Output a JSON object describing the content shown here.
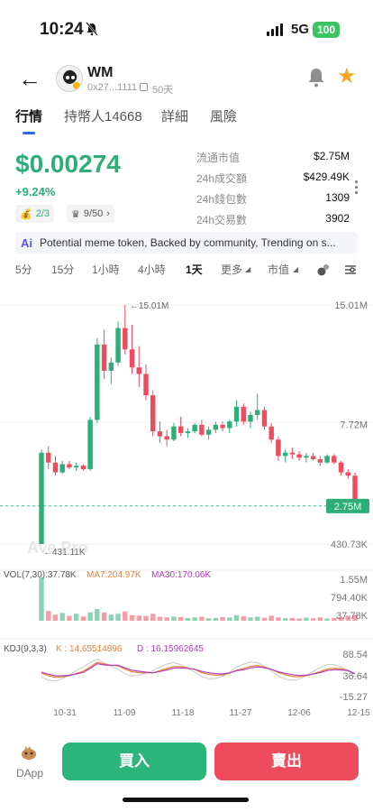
{
  "status_bar": {
    "time": "10:24",
    "network": "5G",
    "battery": "100"
  },
  "header": {
    "token_name": "WM",
    "address": "0x27...1111",
    "age": "50天"
  },
  "tabs": [
    {
      "label": "行情",
      "active": true
    },
    {
      "label": "持幣人14668",
      "active": false
    },
    {
      "label": "詳細",
      "active": false
    },
    {
      "label": "風險",
      "active": false
    }
  ],
  "price": {
    "value": "$0.00274",
    "change": "+9.24%"
  },
  "chips": {
    "dev": "2/3",
    "top": "9/50"
  },
  "stats": [
    {
      "label": "流通市值",
      "value": "$2.75M"
    },
    {
      "label": "24h成交額",
      "value": "$429.49K"
    },
    {
      "label": "24h錢包數",
      "value": "1309"
    },
    {
      "label": "24h交易數",
      "value": "3902"
    }
  ],
  "ai_summary": {
    "badge": "Ai",
    "text": "Potential meme token, Backed by community, Trending on s..."
  },
  "timeframes": [
    {
      "label": "5分",
      "active": false
    },
    {
      "label": "15分",
      "active": false
    },
    {
      "label": "1小時",
      "active": false
    },
    {
      "label": "4小時",
      "active": false
    },
    {
      "label": "1天",
      "active": true
    },
    {
      "label": "更多",
      "active": false
    },
    {
      "label": "市值",
      "active": false
    }
  ],
  "chart_data": {
    "type": "candlestick",
    "price_labels": [
      "15.01M",
      "7.72M",
      "430.73K"
    ],
    "current_label": "2.75M",
    "high_marker": "15.01M",
    "low_marker": "431.11K",
    "watermark": "Ave Pro",
    "volume_legend": {
      "title": "VOL(7,30):37.78K",
      "ma7": "MA7:204.97K",
      "ma30": "MA30:170.06K"
    },
    "volume_labels": [
      "1.55M",
      "794.40K",
      "37.78K"
    ],
    "kdj_legend": {
      "title": "KDJ(9,3,3)",
      "k": "K : 14.65514896",
      "d": "D : 16.15962645"
    },
    "kdj_labels": [
      "88.54",
      "36.64",
      "-15.27"
    ],
    "x_labels": [
      "10-31",
      "11-09",
      "11-18",
      "11-27",
      "12-06",
      "12-15"
    ],
    "candles": [
      [
        0.43,
        6.2,
        0.43,
        6.0
      ],
      [
        6.0,
        6.4,
        5.0,
        5.4
      ],
      [
        5.4,
        5.8,
        4.6,
        4.8
      ],
      [
        4.8,
        5.5,
        4.7,
        5.3
      ],
      [
        5.3,
        5.5,
        5.0,
        5.1
      ],
      [
        5.1,
        5.4,
        4.9,
        5.2
      ],
      [
        5.2,
        5.3,
        4.9,
        5.0
      ],
      [
        5.0,
        8.2,
        4.9,
        8.0
      ],
      [
        8.0,
        13.0,
        7.8,
        12.6
      ],
      [
        12.6,
        13.5,
        10.5,
        11.0
      ],
      [
        11.0,
        11.8,
        10.2,
        11.5
      ],
      [
        11.5,
        14.0,
        11.3,
        13.6
      ],
      [
        13.6,
        15.01,
        12.0,
        12.3
      ],
      [
        12.3,
        13.8,
        10.8,
        11.2
      ],
      [
        11.2,
        12.5,
        10.0,
        10.8
      ],
      [
        10.8,
        11.4,
        9.2,
        9.5
      ],
      [
        9.5,
        9.8,
        7.0,
        7.3
      ],
      [
        7.3,
        7.9,
        6.6,
        7.0
      ],
      [
        7.0,
        7.4,
        6.4,
        6.8
      ],
      [
        6.8,
        7.8,
        6.7,
        7.6
      ],
      [
        7.6,
        8.2,
        7.0,
        7.2
      ],
      [
        7.2,
        7.5,
        6.9,
        7.3
      ],
      [
        7.3,
        7.8,
        7.2,
        7.7
      ],
      [
        7.7,
        8.0,
        7.0,
        7.1
      ],
      [
        7.1,
        7.6,
        6.8,
        7.4
      ],
      [
        7.4,
        7.9,
        7.2,
        7.7
      ],
      [
        7.7,
        7.9,
        7.3,
        7.5
      ],
      [
        7.5,
        8.0,
        7.2,
        7.9
      ],
      [
        7.9,
        9.2,
        7.6,
        8.8
      ],
      [
        8.8,
        9.0,
        7.7,
        7.9
      ],
      [
        7.9,
        8.5,
        7.5,
        8.3
      ],
      [
        8.3,
        9.6,
        8.0,
        8.6
      ],
      [
        8.6,
        8.8,
        7.4,
        7.6
      ],
      [
        7.6,
        7.8,
        6.6,
        6.8
      ],
      [
        6.8,
        7.0,
        5.5,
        5.8
      ],
      [
        5.8,
        6.2,
        5.4,
        6.0
      ],
      [
        6.0,
        6.3,
        5.6,
        5.9
      ],
      [
        5.9,
        6.1,
        5.5,
        5.7
      ],
      [
        5.7,
        6.0,
        5.4,
        5.8
      ],
      [
        5.8,
        6.0,
        5.5,
        5.6
      ],
      [
        5.6,
        5.8,
        5.2,
        5.4
      ],
      [
        5.4,
        5.9,
        5.3,
        5.8
      ],
      [
        5.8,
        5.9,
        5.3,
        5.4
      ],
      [
        5.4,
        5.5,
        4.6,
        4.8
      ],
      [
        4.8,
        5.0,
        4.4,
        4.6
      ],
      [
        4.6,
        4.8,
        2.6,
        2.75
      ]
    ],
    "volumes": [
      1.55,
      0.35,
      0.22,
      0.28,
      0.18,
      0.25,
      0.15,
      0.3,
      0.42,
      0.3,
      0.22,
      0.25,
      0.33,
      0.2,
      0.18,
      0.17,
      0.25,
      0.14,
      0.12,
      0.15,
      0.13,
      0.1,
      0.12,
      0.14,
      0.09,
      0.1,
      0.13,
      0.12,
      0.2,
      0.16,
      0.12,
      0.14,
      0.11,
      0.18,
      0.12,
      0.09,
      0.1,
      0.08,
      0.11,
      0.09,
      0.12,
      0.08,
      0.1,
      0.13,
      0.18,
      0.21
    ]
  },
  "actions": {
    "dapp": "DApp",
    "buy": "買入",
    "sell": "賣出"
  },
  "colors": {
    "up": "#2cae76",
    "down": "#ee4b5e",
    "accent": "#2b66f6",
    "ma7": "#e8833a",
    "ma30": "#b23fbf"
  }
}
